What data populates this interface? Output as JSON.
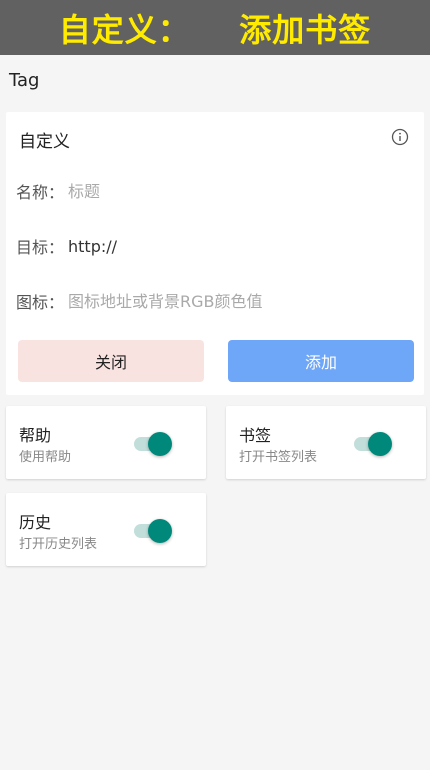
{
  "banner": {
    "title": "自定义：    添加书签"
  },
  "page": {
    "label": "Tag"
  },
  "form": {
    "title": "自定义",
    "info_icon": "info-circle-icon",
    "name": {
      "label": "名称：",
      "value": "",
      "placeholder": "标题"
    },
    "target": {
      "label": "目标：",
      "value": "http://",
      "placeholder": ""
    },
    "icon": {
      "label": "图标：",
      "value": "",
      "placeholder": "图标地址或背景RGB颜色值"
    },
    "close_label": "关闭",
    "add_label": "添加"
  },
  "toggles": [
    {
      "title": "帮助",
      "subtitle": "使用帮助",
      "enabled": true
    },
    {
      "title": "书签",
      "subtitle": "打开书签列表",
      "enabled": true
    },
    {
      "title": "历史",
      "subtitle": "打开历史列表",
      "enabled": true
    }
  ],
  "colors": {
    "banner_bg": "#616161",
    "banner_text": "#ffeb00",
    "close_button_bg": "#f9e3e1",
    "add_button_bg": "#6ea6f8",
    "switch_thumb": "#00897b",
    "switch_track": "#c2dedb"
  }
}
